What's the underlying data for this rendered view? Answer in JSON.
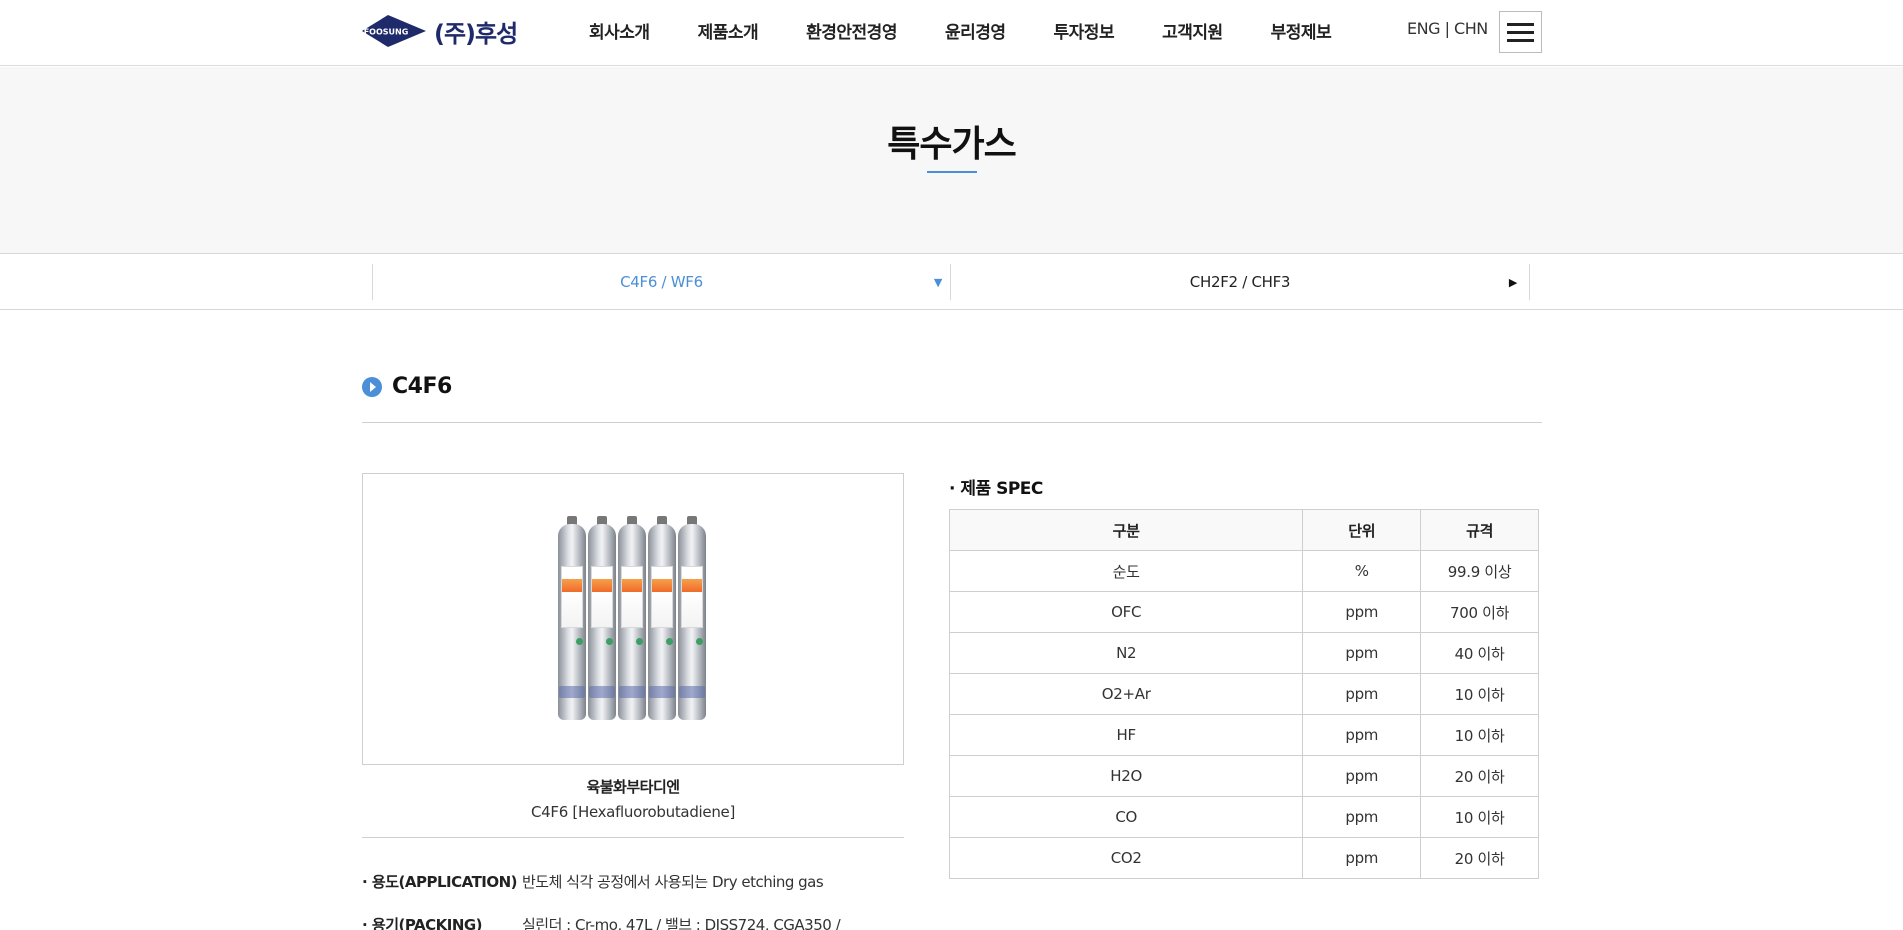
{
  "header": {
    "logo_mark": "FOOSUNG",
    "logo_text": "(주)후성",
    "nav": [
      "회사소개",
      "제품소개",
      "환경안전경영",
      "윤리경영",
      "투자정보",
      "고객지원",
      "부정제보"
    ],
    "lang_eng": "ENG",
    "lang_sep": " | ",
    "lang_chn": "CHN"
  },
  "page": {
    "title": "특수가스"
  },
  "subtabs": [
    {
      "label": "C4F6 / WF6",
      "active": true
    },
    {
      "label": "CH2F2 / CHF3",
      "active": false
    }
  ],
  "section": {
    "title": "C4F6"
  },
  "product": {
    "name_ko": "육불화부타디엔",
    "name_en": "C4F6 [Hexafluorobutadiene]",
    "cylinder_label": "C4F6",
    "info": [
      {
        "key": "· 용도(APPLICATION)",
        "value": "반도체 식각 공정에서 사용되는 Dry etching gas"
      },
      {
        "key": "· 용기(PACKING)",
        "value": "실린더 : Cr-mo, 47L / 밸브 : DISS724, CGA350 /"
      }
    ]
  },
  "spec": {
    "title": "· 제품 SPEC",
    "headers": [
      "구분",
      "단위",
      "규격"
    ],
    "rows": [
      [
        "순도",
        "%",
        "99.9 이상"
      ],
      [
        "OFC",
        "ppm",
        "700 이하"
      ],
      [
        "N2",
        "ppm",
        "40 이하"
      ],
      [
        "O2+Ar",
        "ppm",
        "10 이하"
      ],
      [
        "HF",
        "ppm",
        "10 이하"
      ],
      [
        "H2O",
        "ppm",
        "20 이하"
      ],
      [
        "CO",
        "ppm",
        "10 이하"
      ],
      [
        "CO2",
        "ppm",
        "20 이하"
      ]
    ]
  },
  "colors": {
    "accent": "#4a8fd8",
    "logo_navy": "#1f2a6b"
  }
}
